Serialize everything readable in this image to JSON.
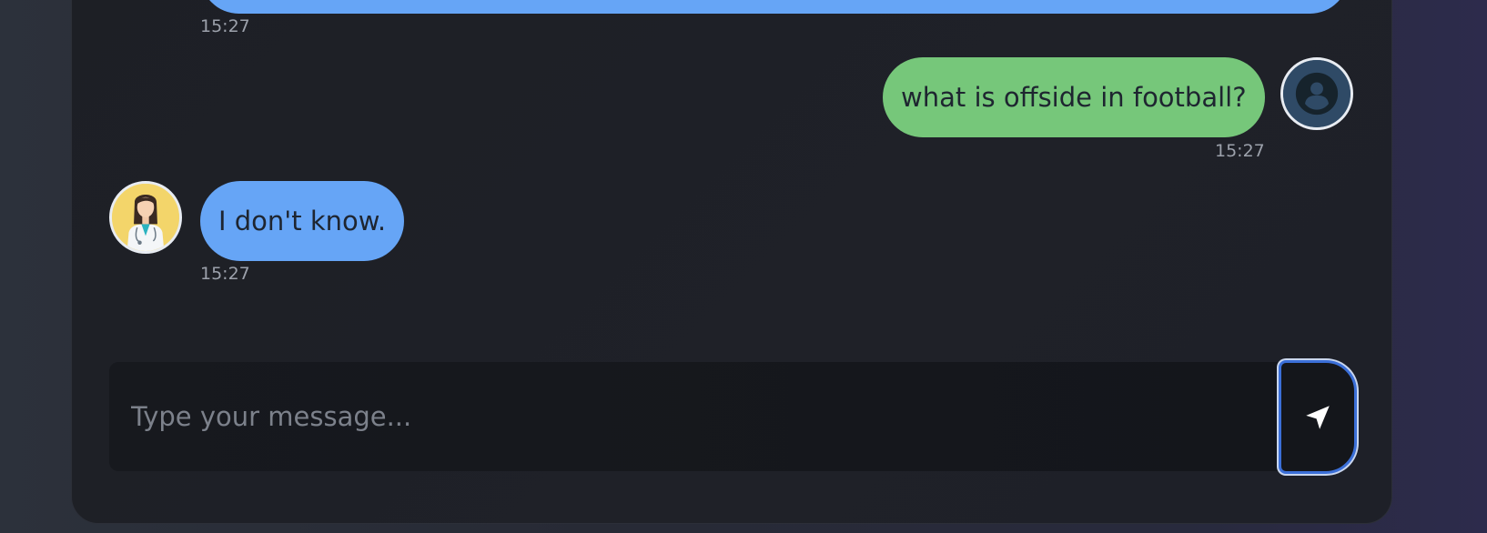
{
  "messages": [
    {
      "sender": "bot",
      "text": "",
      "time": "15:27"
    },
    {
      "sender": "user",
      "text": "what is offside in football?",
      "time": "15:27",
      "avatar_icon": "user-icon"
    },
    {
      "sender": "bot",
      "text": "I don't know.",
      "time": "15:27",
      "avatar_icon": "doctor-avatar"
    }
  ],
  "composer": {
    "placeholder": "Type your message...",
    "send_icon": "send-arrow-icon"
  },
  "colors": {
    "bot_bubble": "#66a5f6",
    "user_bubble": "#76c77a",
    "accent": "#3b6fd8"
  }
}
